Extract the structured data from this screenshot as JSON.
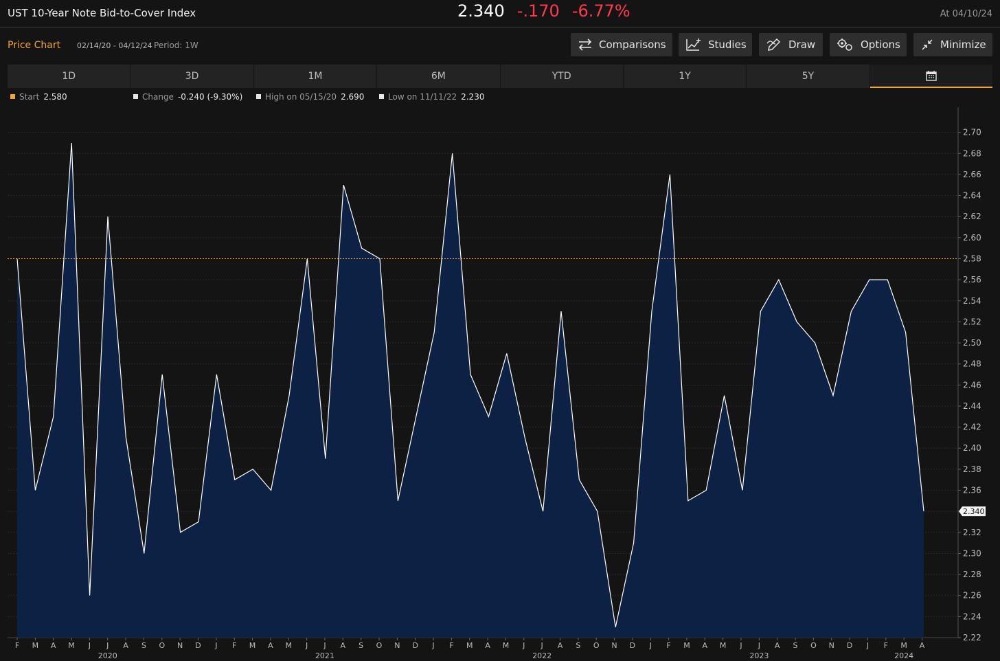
{
  "header": {
    "title": "UST 10-Year Note Bid-to-Cover Index",
    "last": "2.340",
    "change": "-.170",
    "change_pct": "-6.77%",
    "as_of": "At 04/10/24"
  },
  "toolbar": {
    "label": "Price Chart",
    "range": "02/14/20 - 04/12/24",
    "period": "Period: 1W",
    "buttons": [
      "Comparisons",
      "Studies",
      "Draw",
      "Options",
      "Minimize"
    ]
  },
  "tabs": [
    "1D",
    "3D",
    "1M",
    "6M",
    "YTD",
    "1Y",
    "5Y"
  ],
  "stats": {
    "start_label": "Start",
    "start_value": "2.580",
    "change_label": "Change",
    "change_value": "-0.240 (-9.30%)",
    "high_label": "High on 05/15/20",
    "high_value": "2.690",
    "low_label": "Low on 11/11/22",
    "low_value": "2.230"
  },
  "colors": {
    "background": "#141414",
    "accent": "#f7a531",
    "negative": "#ff3b4a",
    "area_fill": "#0c2144",
    "line": "#ffffff"
  },
  "chart_data": {
    "type": "area",
    "x": [
      "2020-02-14",
      "2020-03-12",
      "2020-04-09",
      "2020-05-15",
      "2020-06-10",
      "2020-07-15",
      "2020-08-12",
      "2020-09-10",
      "2020-10-07",
      "2020-11-10",
      "2020-12-08",
      "2021-01-12",
      "2021-02-10",
      "2021-03-10",
      "2021-04-13",
      "2021-05-12",
      "2021-06-09",
      "2021-07-13",
      "2021-08-11",
      "2021-09-13",
      "2021-10-13",
      "2021-11-09",
      "2021-12-09",
      "2022-01-11",
      "2022-02-09",
      "2022-03-09",
      "2022-04-12",
      "2022-05-10",
      "2022-06-08",
      "2022-07-12",
      "2022-08-10",
      "2022-09-12",
      "2022-10-12",
      "2022-11-09",
      "2022-12-07",
      "2023-01-10",
      "2023-02-08",
      "2023-03-08",
      "2023-04-11",
      "2023-05-10",
      "2023-06-12",
      "2023-07-12",
      "2023-08-09",
      "2023-09-12",
      "2023-10-10",
      "2023-11-08",
      "2023-12-12",
      "2024-01-10",
      "2024-02-13",
      "2024-03-12",
      "2024-04-10"
    ],
    "values": [
      2.58,
      2.36,
      2.43,
      2.69,
      2.26,
      2.62,
      2.41,
      2.3,
      2.47,
      2.32,
      2.33,
      2.47,
      2.37,
      2.38,
      2.36,
      2.45,
      2.58,
      2.39,
      2.65,
      2.59,
      2.58,
      2.35,
      2.43,
      2.51,
      2.68,
      2.47,
      2.43,
      2.49,
      2.41,
      2.34,
      2.53,
      2.37,
      2.34,
      2.23,
      2.31,
      2.53,
      2.66,
      2.35,
      2.36,
      2.45,
      2.36,
      2.53,
      2.56,
      2.52,
      2.5,
      2.45,
      2.53,
      2.56,
      2.56,
      2.51,
      2.34
    ],
    "ylim": [
      2.21,
      2.71
    ],
    "y_ticks": [
      "2.70",
      "2.68",
      "2.66",
      "2.64",
      "2.62",
      "2.60",
      "2.58",
      "2.56",
      "2.54",
      "2.52",
      "2.50",
      "2.48",
      "2.46",
      "2.44",
      "2.42",
      "2.40",
      "2.38",
      "2.36",
      "2.34",
      "2.32",
      "2.30",
      "2.28",
      "2.26",
      "2.24",
      "2.22"
    ],
    "x_month_labels": [
      "F",
      "M",
      "A",
      "M",
      "J",
      "J",
      "A",
      "S",
      "O",
      "N",
      "D",
      "J",
      "F",
      "M",
      "A",
      "M",
      "J",
      "J",
      "A",
      "S",
      "O",
      "N",
      "D",
      "J",
      "F",
      "M",
      "A",
      "M",
      "J",
      "J",
      "A",
      "S",
      "O",
      "N",
      "D",
      "J",
      "F",
      "M",
      "A",
      "M",
      "J",
      "J",
      "A",
      "S",
      "O",
      "N",
      "D",
      "J",
      "F",
      "M",
      "A"
    ],
    "x_year_labels": [
      "2020",
      "2021",
      "2022",
      "2023",
      "2024"
    ],
    "reference_line": 2.58,
    "last_value_label": "2.340",
    "grid": true
  }
}
